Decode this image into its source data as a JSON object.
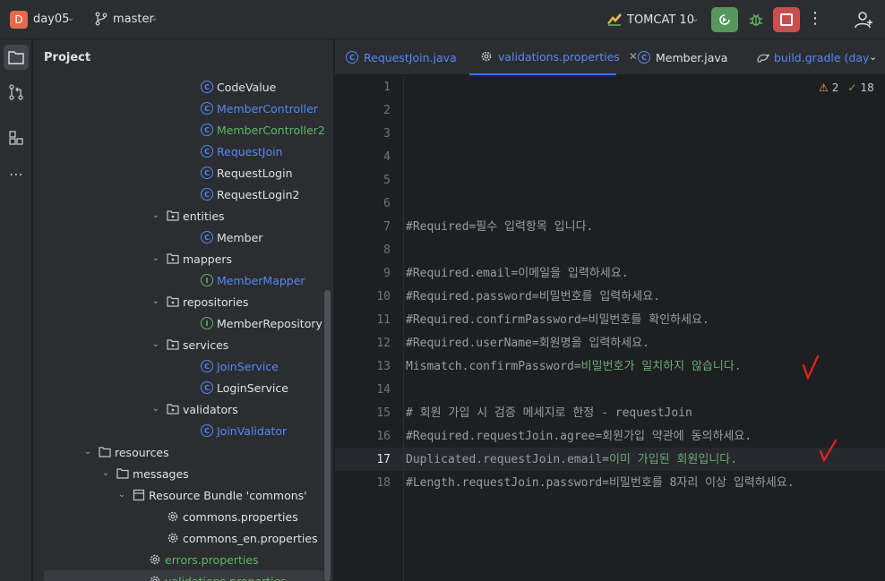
{
  "titlebar": {
    "project_initial": "D",
    "project_name": "day05",
    "branch": "master",
    "run_config": "TOMCAT 10"
  },
  "panel": {
    "title": "Project"
  },
  "tree": [
    {
      "label": "CodeValue",
      "icon": "class-icon",
      "color": "default",
      "indent": 224
    },
    {
      "label": "MemberController",
      "icon": "class-icon",
      "color": "blue",
      "indent": 224
    },
    {
      "label": "MemberController2",
      "icon": "class-icon",
      "color": "green",
      "indent": 224
    },
    {
      "label": "RequestJoin",
      "icon": "class-icon",
      "color": "blue",
      "indent": 224
    },
    {
      "label": "RequestLogin",
      "icon": "class-icon",
      "color": "default",
      "indent": 224
    },
    {
      "label": "RequestLogin2",
      "icon": "class-icon",
      "color": "default",
      "indent": 224
    },
    {
      "label": "entities",
      "icon": "package-icon",
      "color": "default",
      "indent": 186,
      "chevron": true
    },
    {
      "label": "Member",
      "icon": "class-icon",
      "color": "default",
      "indent": 224
    },
    {
      "label": "mappers",
      "icon": "package-icon",
      "color": "default",
      "indent": 186,
      "chevron": true
    },
    {
      "label": "MemberMapper",
      "icon": "interface-icon",
      "color": "blue",
      "indent": 224
    },
    {
      "label": "repositories",
      "icon": "package-icon",
      "color": "default",
      "indent": 186,
      "chevron": true
    },
    {
      "label": "MemberRepository",
      "icon": "interface-icon",
      "color": "default",
      "indent": 224
    },
    {
      "label": "services",
      "icon": "package-icon",
      "color": "default",
      "indent": 186,
      "chevron": true
    },
    {
      "label": "JoinService",
      "icon": "class-icon",
      "color": "blue",
      "indent": 224
    },
    {
      "label": "LoginService",
      "icon": "class-icon",
      "color": "default",
      "indent": 224
    },
    {
      "label": "validators",
      "icon": "package-icon",
      "color": "default",
      "indent": 186,
      "chevron": true
    },
    {
      "label": "JoinValidator",
      "icon": "class-icon",
      "color": "blue",
      "indent": 224
    },
    {
      "label": "resources",
      "icon": "folder-icon",
      "color": "default",
      "indent": 110,
      "chevron": true
    },
    {
      "label": "messages",
      "icon": "folder-icon",
      "color": "default",
      "indent": 130,
      "chevron": true
    },
    {
      "label": "Resource Bundle 'commons'",
      "icon": "bundle-icon",
      "color": "default",
      "indent": 148,
      "chevron": true
    },
    {
      "label": "commons.properties",
      "icon": "gear-icon",
      "color": "default",
      "indent": 186
    },
    {
      "label": "commons_en.properties",
      "icon": "gear-icon",
      "color": "default",
      "indent": 186
    },
    {
      "label": "errors.properties",
      "icon": "gear-icon",
      "color": "green",
      "indent": 166
    },
    {
      "label": "validations.properties",
      "icon": "gear-icon",
      "color": "green",
      "indent": 166,
      "selected": true
    }
  ],
  "tabs": [
    {
      "label": "RequestJoin.java",
      "icon": "class-icon"
    },
    {
      "label": "validations.properties",
      "icon": "gear-icon",
      "active": true
    },
    {
      "label": "Member.java",
      "icon": "class-icon"
    },
    {
      "label": "build.gradle (day",
      "icon": "gradle-icon"
    }
  ],
  "inspections": {
    "warnings": "2",
    "ok": "18"
  },
  "lines": [
    {
      "n": "1",
      "key": "",
      "val": ""
    },
    {
      "n": "2",
      "key": "",
      "val": ""
    },
    {
      "n": "3",
      "key": "",
      "val": ""
    },
    {
      "n": "4",
      "key": "",
      "val": ""
    },
    {
      "n": "5",
      "key": "",
      "val": ""
    },
    {
      "n": "6",
      "key": "",
      "val": ""
    },
    {
      "n": "7",
      "key": "#Required=필수 입력항목 입니다.",
      "val": ""
    },
    {
      "n": "8",
      "key": "",
      "val": ""
    },
    {
      "n": "9",
      "key": "#Required.email=이메일을 입력하세요.",
      "val": ""
    },
    {
      "n": "10",
      "key": "#Required.password=비밀번호를 입력하세요.",
      "val": ""
    },
    {
      "n": "11",
      "key": "#Required.confirmPassword=비밀번호를 확인하세요.",
      "val": ""
    },
    {
      "n": "12",
      "key": "#Required.userName=회원명을 입력하세요.",
      "val": ""
    },
    {
      "n": "13",
      "key": "Mismatch.confirmPassword=",
      "val": "비밀번호가 일치하지 않습니다."
    },
    {
      "n": "14",
      "key": "",
      "val": ""
    },
    {
      "n": "15",
      "key": "# 회원 가입 시 검증 메세지로 한정 - requestJoin",
      "val": ""
    },
    {
      "n": "16",
      "key": "#Required.requestJoin.agree=회원가입 약관에 동의하세요.",
      "val": ""
    },
    {
      "n": "17",
      "key": "Duplicated.requestJoin.email=",
      "val": "이미 가입된 회원입니다."
    },
    {
      "n": "18",
      "key": "#Length.requestJoin.password=비밀번호를 8자리 이상 입력하세요.",
      "val": ""
    }
  ],
  "current_line": "17",
  "colors": {
    "accent": "#3574f0",
    "run": "#57965c",
    "stop": "#c94f4f",
    "annotation": "#e5231b"
  }
}
